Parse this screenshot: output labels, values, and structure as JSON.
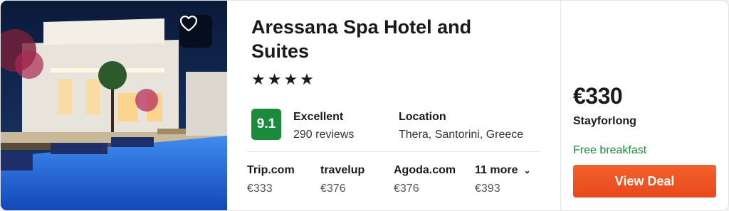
{
  "hotel": {
    "name": "Aressana Spa Hotel and Suites",
    "stars": "★★★★",
    "rating": {
      "score": "9.1",
      "label": "Excellent",
      "reviews": "290 reviews"
    },
    "location": {
      "label": "Location",
      "value": "Thera, Santorini, Greece"
    }
  },
  "offers": [
    {
      "site": "Trip.com",
      "price": "€333"
    },
    {
      "site": "travelup",
      "price": "€376"
    },
    {
      "site": "Agoda.com",
      "price": "€376"
    },
    {
      "site": "11 more",
      "price": "€393"
    }
  ],
  "deal": {
    "price": "€330",
    "provider": "Stayforlong",
    "perk": "Free breakfast",
    "button": "View Deal"
  },
  "colors": {
    "rating_badge": "#1a8a3c",
    "perk_text": "#1f8a3d",
    "deal_button": "#ef5a27"
  },
  "icons": {
    "favorite": "heart-outline-icon",
    "more": "chevron-down-icon"
  }
}
